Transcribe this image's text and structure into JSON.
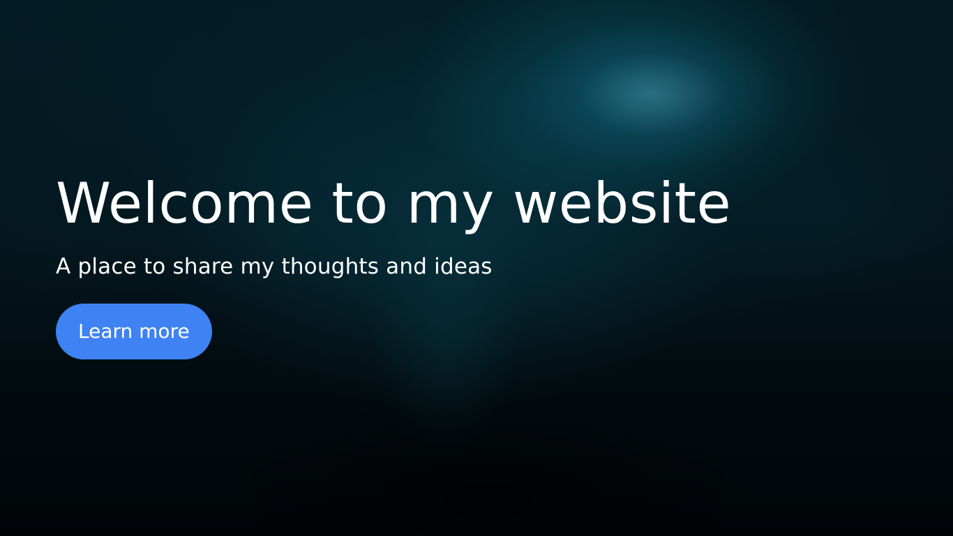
{
  "hero": {
    "title": "Welcome to my website",
    "subtitle": "A place to share my thoughts and ideas",
    "cta_label": "Learn more"
  },
  "colors": {
    "button_background": "#3f82f3",
    "text": "#ffffff",
    "background_dark": "#02080c",
    "background_accent": "#0a5f73"
  }
}
